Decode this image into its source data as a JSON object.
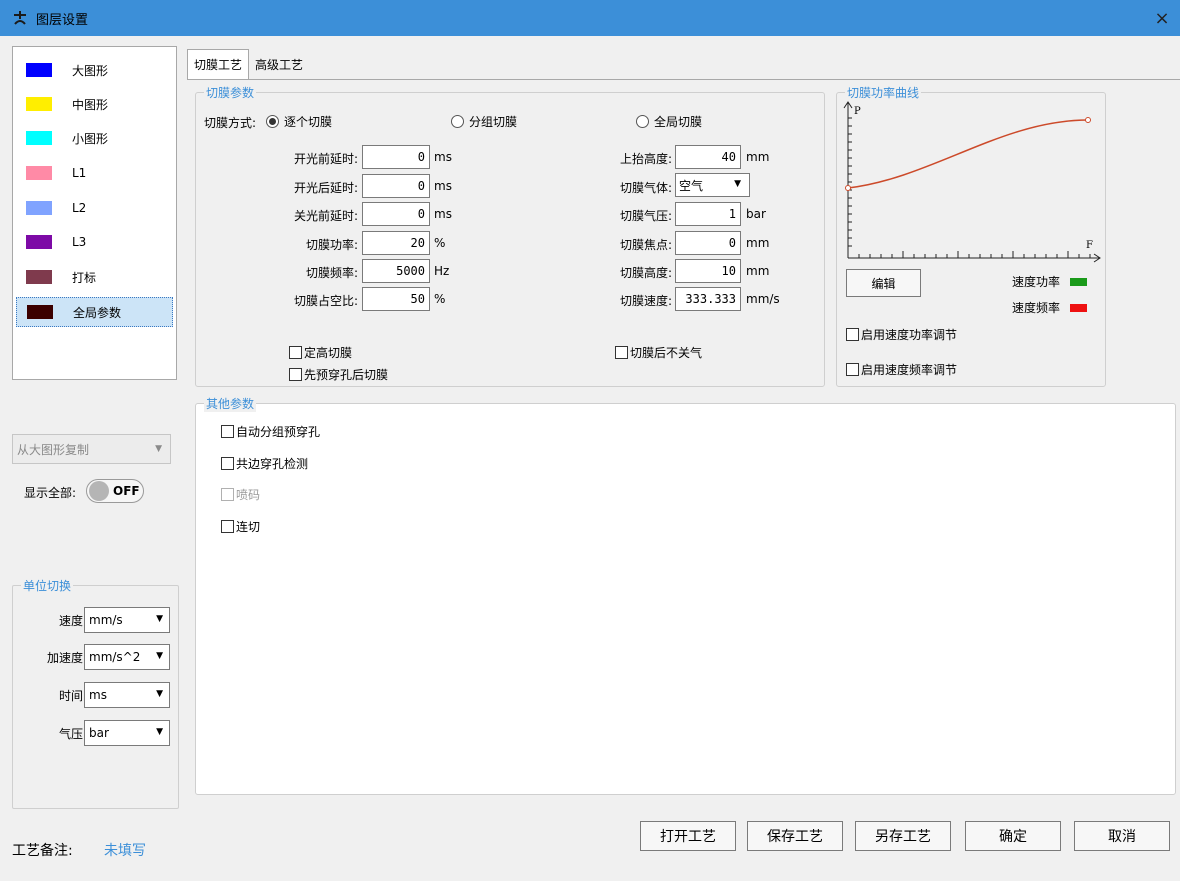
{
  "window": {
    "title": "图层设置",
    "close_symbol": "×"
  },
  "layers": [
    {
      "label": "大图形",
      "color": "#0000ff"
    },
    {
      "label": "中图形",
      "color": "#ffee00"
    },
    {
      "label": "小图形",
      "color": "#00ffff"
    },
    {
      "label": "L1",
      "color": "#ff8aa6"
    },
    {
      "label": "L2",
      "color": "#80a3ff"
    },
    {
      "label": "L3",
      "color": "#7d0aa6"
    },
    {
      "label": "打标",
      "color": "#7f3a4d"
    },
    {
      "label": "全局参数",
      "color": "#3b0000",
      "selected": true
    }
  ],
  "left": {
    "copy_from": "从大图形复制",
    "show_all_label": "显示全部:",
    "toggle_text": "OFF",
    "unit_group_title": "单位切换",
    "units": [
      {
        "label": "速度:",
        "value": "mm/s"
      },
      {
        "label": "加速度:",
        "value": "mm/s^2"
      },
      {
        "label": "时间:",
        "value": "ms"
      },
      {
        "label": "气压:",
        "value": "bar"
      }
    ],
    "remark_label": "工艺备注:",
    "remark_value": "未填写"
  },
  "tabs": [
    {
      "label": "切膜工艺",
      "active": true
    },
    {
      "label": "高级工艺",
      "active": false
    }
  ],
  "cut": {
    "group_title": "切膜参数",
    "mode_label": "切膜方式:",
    "modes": [
      {
        "label": "逐个切膜",
        "selected": true
      },
      {
        "label": "分组切膜",
        "selected": false
      },
      {
        "label": "全局切膜",
        "selected": false
      }
    ],
    "left_fields": [
      {
        "label": "开光前延时:",
        "value": "0",
        "unit": "ms"
      },
      {
        "label": "开光后延时:",
        "value": "0",
        "unit": "ms"
      },
      {
        "label": "关光前延时:",
        "value": "0",
        "unit": "ms"
      },
      {
        "label": "切膜功率:",
        "value": "20",
        "unit": "%"
      },
      {
        "label": "切膜频率:",
        "value": "5000",
        "unit": "Hz"
      },
      {
        "label": "切膜占空比:",
        "value": "50",
        "unit": "%"
      }
    ],
    "right_fields": {
      "lift_height": {
        "label": "上抬高度:",
        "value": "40",
        "unit": "mm"
      },
      "gas": {
        "label": "切膜气体:",
        "value": "空气"
      },
      "pressure": {
        "label": "切膜气压:",
        "value": "1",
        "unit": "bar"
      },
      "focus": {
        "label": "切膜焦点:",
        "value": "0",
        "unit": "mm"
      },
      "height": {
        "label": "切膜高度:",
        "value": "10",
        "unit": "mm"
      },
      "speed": {
        "label": "切膜速度:",
        "value": "333.333",
        "unit": "mm/s"
      }
    },
    "checks": {
      "fixed_height": "定高切膜",
      "prepierce_first": "先预穿孔后切膜",
      "keep_gas": "切膜后不关气"
    }
  },
  "curve": {
    "group_title": "切膜功率曲线",
    "y_axis_label": "P",
    "x_axis_label": "F",
    "edit_button": "编辑",
    "legend": [
      {
        "label": "速度功率",
        "color": "#1a9a1a"
      },
      {
        "label": "速度频率",
        "color": "#ee1111"
      }
    ],
    "line_color": "#cc4a2a",
    "enable_speed_power": "启用速度功率调节",
    "enable_speed_freq": "启用速度频率调节"
  },
  "other": {
    "group_title": "其他参数",
    "checks": [
      {
        "label": "自动分组预穿孔",
        "disabled": false
      },
      {
        "label": "共边穿孔检测",
        "disabled": false
      },
      {
        "label": "喷码",
        "disabled": true
      },
      {
        "label": "连切",
        "disabled": false
      }
    ]
  },
  "footer": {
    "open": "打开工艺",
    "save": "保存工艺",
    "save_as": "另存工艺",
    "ok": "确定",
    "cancel": "取消"
  }
}
